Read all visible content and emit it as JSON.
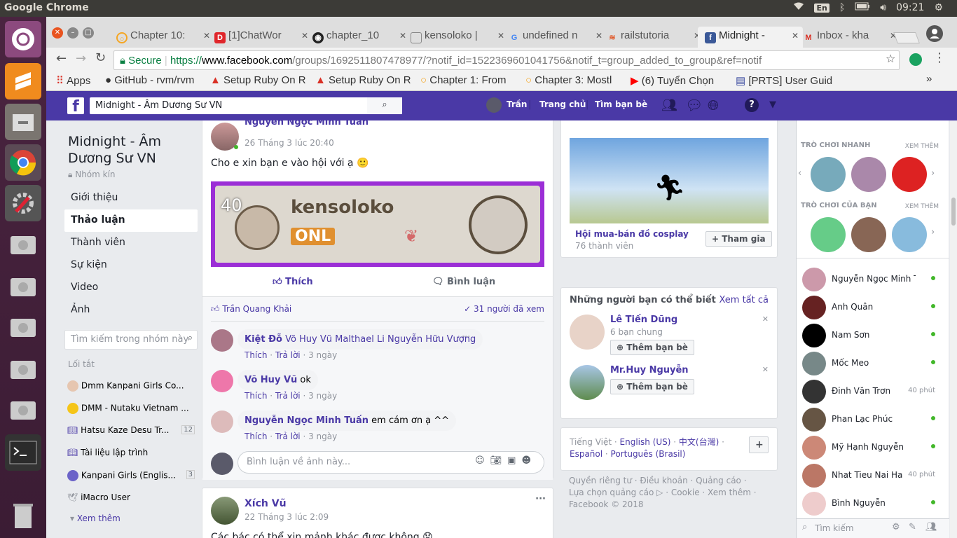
{
  "os": {
    "app_name": "Google Chrome",
    "kb_layout": "En",
    "time": "09:21"
  },
  "tabs": [
    {
      "label": "Chapter 10: ",
      "icon": "O",
      "color": "#f5a623"
    },
    {
      "label": "[1]ChatWor",
      "icon": "D",
      "color": "#e0262b"
    },
    {
      "label": "chapter_10",
      "icon": "gh",
      "color": "#222"
    },
    {
      "label": "kensoloko |",
      "icon": "doc",
      "color": "#888"
    },
    {
      "label": "undefined n",
      "icon": "G",
      "color": "#4285f4"
    },
    {
      "label": "railstutoria",
      "icon": "rt",
      "color": "#e05a2b"
    },
    {
      "label": "Midnight - ",
      "icon": "f",
      "color": "#3b5998"
    },
    {
      "label": "Inbox - kha",
      "icon": "M",
      "color": "#d93025"
    }
  ],
  "url": {
    "secure_label": "Secure",
    "protocol": "https://",
    "domain": "www.facebook.com",
    "path": "/groups/1692511807478977/?notif_id=1522369601041756&notif_t=group_added_to_group&ref=notif"
  },
  "bookmarks": [
    {
      "label": "Apps"
    },
    {
      "label": "GitHub - rvm/rvm"
    },
    {
      "label": "Setup Ruby On R"
    },
    {
      "label": "Setup Ruby On R"
    },
    {
      "label": "Chapter 1: From"
    },
    {
      "label": "Chapter 3: Mostl"
    },
    {
      "label": "(6) Tuyển Chọn"
    },
    {
      "label": "[PRTS] User Guid"
    }
  ],
  "fb": {
    "search_value": "Midnight  - Âm Dương Sư VN",
    "user_name": "Trần",
    "nav_home": "Trang chủ",
    "nav_find_friends": "Tìm bạn bè",
    "group": {
      "title": "Midnight - Âm Dương Sư VN",
      "privacy": "Nhóm kín"
    },
    "left_nav": [
      "Giới thiệu",
      "Thảo luận",
      "Thành viên",
      "Sự kiện",
      "Video",
      "Ảnh"
    ],
    "group_search_placeholder": "Tìm kiếm trong nhóm này",
    "shortcuts_title": "Lối tắt",
    "shortcuts": [
      {
        "label": "Dmm Kanpani Girls Co...",
        "count": ""
      },
      {
        "label": "DMM - Nutaku Vietnam ...",
        "count": ""
      },
      {
        "label": "Hatsu Kaze Desu Tr...",
        "count": "12"
      },
      {
        "label": "Tài liệu lập trình",
        "count": ""
      },
      {
        "label": "Kanpani Girls (Englis...",
        "count": "3"
      },
      {
        "label": "iMacro User",
        "count": ""
      }
    ],
    "see_more": "Xem thêm",
    "post1": {
      "author": "Nguyễn Ngọc Minh Tuấn",
      "time": "26 Tháng 3 lúc 20:40",
      "text": "Cho e xin bạn e vào hội với ạ 🙂",
      "image_level": "40",
      "image_name": "kensoloko",
      "image_status": "ONL",
      "like": "Thích",
      "comment": "Bình luận",
      "liker": "Trần Quang Khải",
      "seen": "31 người đã xem"
    },
    "comments": [
      {
        "author": "Kiệt Đỗ",
        "text": "Võ Huy Vũ Malthael Li Nguyễn Hữu Vượng",
        "like": "Thích",
        "reply": "Trả lời",
        "time": "3 ngày"
      },
      {
        "author": "Võ Huy Vũ",
        "text": "ok",
        "like": "Thích",
        "reply": "Trả lời",
        "time": "3 ngày"
      },
      {
        "author": "Nguyễn Ngọc Minh Tuấn",
        "text": "em cám ơn ạ ^^",
        "like": "Thích",
        "reply": "Trả lời",
        "time": "3 ngày"
      }
    ],
    "comment_placeholder": "Bình luận về ảnh này...",
    "post2": {
      "author": "Xích Vũ",
      "time": "22 Tháng 3 lúc 2:09",
      "text": "Các bác có thể xin mảnh khác được không 😟"
    },
    "suggested_group": {
      "name": "Hội mua-bán đồ cosplay",
      "members": "76 thành viên",
      "join": "Tham gia"
    },
    "pymk": {
      "title": "Những người bạn có thể biết",
      "see_all": "Xem tất cả",
      "people": [
        {
          "name": "Lê Tiến Dũng",
          "mutual": "6 bạn chung",
          "add": "Thêm bạn bè"
        },
        {
          "name": "Mr.Huy Nguyễn",
          "mutual": "",
          "add": "Thêm bạn bè"
        }
      ]
    },
    "languages": {
      "current": "Tiếng Việt",
      "others": [
        "English (US)",
        "中文(台灣)",
        "Español",
        "Português (Brasil)"
      ]
    },
    "footer": [
      "Quyền riêng tư",
      "Điều khoản",
      "Quảng cáo",
      "Lựa chọn quảng cáo",
      "Cookie",
      "Xem thêm",
      "Facebook © 2018"
    ],
    "games": {
      "quick_title": "TRÒ CHƠI NHANH",
      "your_title": "TRÒ CHƠI CỦA BẠN",
      "see_more": "XEM THÊM"
    },
    "contacts": [
      {
        "name": "Nguyễn Ngọc Minh T...",
        "status": "online"
      },
      {
        "name": "Anh Quân",
        "status": "online"
      },
      {
        "name": "Nam Sơn",
        "status": "online"
      },
      {
        "name": "Mốc Meo",
        "status": "online"
      },
      {
        "name": "Đinh Văn Trơn",
        "status": "40 phút"
      },
      {
        "name": "Phan Lạc Phúc",
        "status": "online"
      },
      {
        "name": "Mỹ Hạnh Nguyễn",
        "status": "online"
      },
      {
        "name": "Nhat Tieu Nai Ha",
        "status": "40 phút"
      },
      {
        "name": "Bình Nguyễn",
        "status": "online"
      }
    ],
    "chat_search_placeholder": "Tìm kiếm"
  }
}
